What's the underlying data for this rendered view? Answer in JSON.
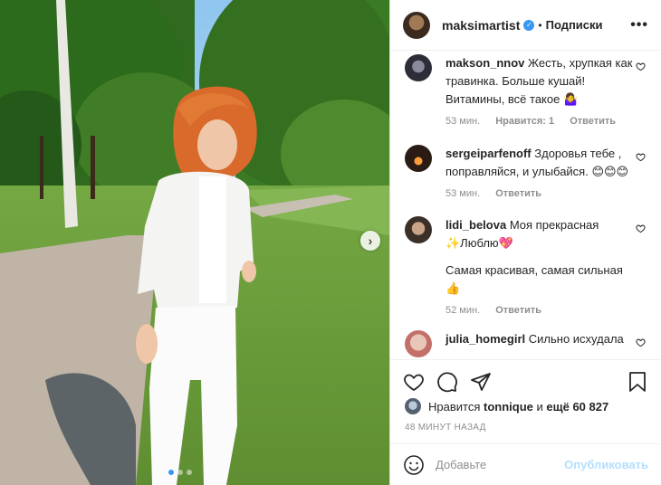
{
  "post": {
    "author": "maksimartist",
    "follow_separator": "•",
    "follow_status": "Подписки",
    "more_icon": "•••",
    "carousel": {
      "next_icon": "chevron-right-icon",
      "slide_count": 3,
      "active_slide": 1
    }
  },
  "comments": [
    {
      "user": "makson_nnov",
      "text": "Жесть, хрупкая как травинка. Больше кушай! Витамины, всё такое 🤷‍♀️",
      "time": "53 мин.",
      "likes": "Нравится: 1",
      "reply": "Ответить"
    },
    {
      "user": "sergeiparfenoff",
      "text": "Здоровья тебе , поправляйся, и улыбайся. 😊😊😊",
      "time": "53 мин.",
      "reply": "Ответить"
    },
    {
      "user": "lidi_belova",
      "text": "Моя прекрасная ✨Люблю💖",
      "text2": "Самая красивая, самая сильная 👍",
      "time": "52 мин.",
      "reply": "Ответить"
    },
    {
      "user": "julia_homegirl",
      "text": "Сильно исхудала"
    }
  ],
  "actions": {
    "like_icon": "heart-icon",
    "comment_icon": "comment-icon",
    "share_icon": "send-icon",
    "save_icon": "bookmark-icon"
  },
  "likes": {
    "prefix": "Нравится",
    "user": "tonnique",
    "middle": "и",
    "rest": "ещё 60 827"
  },
  "timestamp": "48 МИНУТ НАЗАД",
  "composer": {
    "placeholder": "Добавьте",
    "publish_label": "Опубликовать",
    "emoji_icon": "smiley-icon"
  },
  "colors": {
    "accent": "#3897f0",
    "publish_disabled": "#b2dffc",
    "muted": "#8e8e8e",
    "text": "#262626"
  }
}
